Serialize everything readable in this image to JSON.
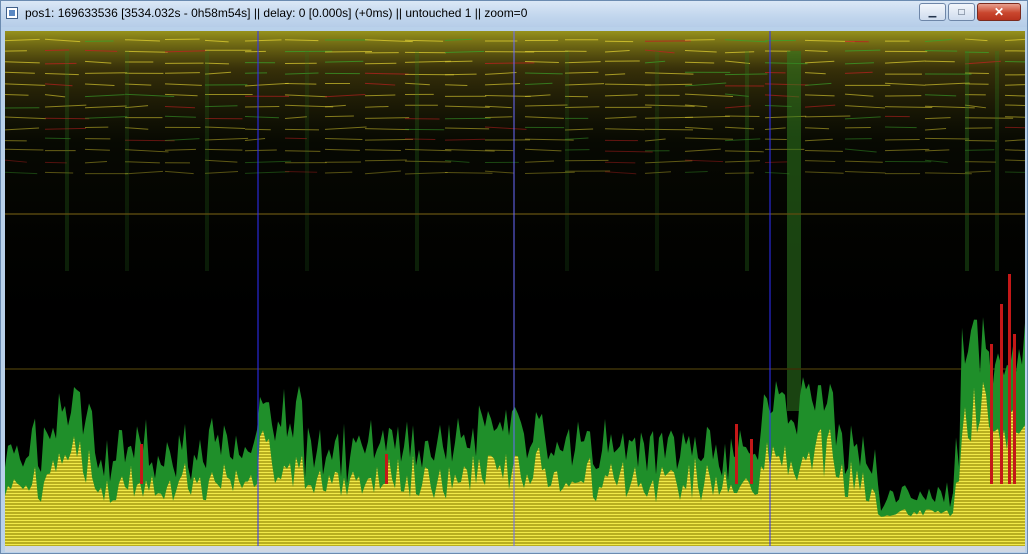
{
  "window": {
    "title": "pos1: 169633536 [3534.032s - 0h58m54s] || delay: 0 [0.000s] (+0ms) || untouched 1 || zoom=0",
    "controls": {
      "minimize": "▁",
      "maximize": "□",
      "close": "✕"
    }
  },
  "colors": {
    "titlebar": "#c3d7ee",
    "background": "#000000",
    "spectrum_yellow": "#d8d23a",
    "spectrum_green": "#1f8f2a",
    "spectrum_red": "#c41818",
    "marker_blue": "#3030ff"
  }
}
